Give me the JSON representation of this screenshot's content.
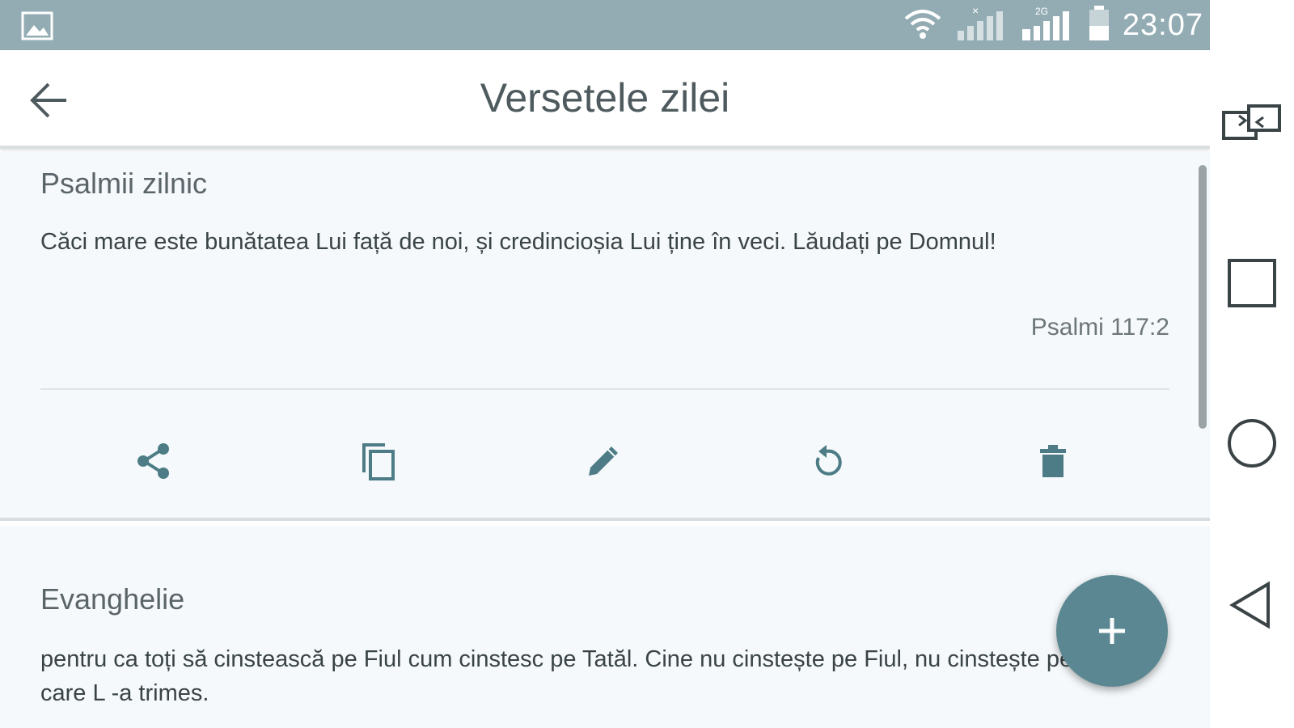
{
  "status_bar": {
    "time": "23:07",
    "icons": [
      "image-icon",
      "wifi-icon",
      "signal-icon",
      "signal-2g-icon",
      "battery-icon"
    ]
  },
  "toolbar": {
    "title": "Versetele zilei",
    "back_icon": "arrow-back-icon"
  },
  "cards": [
    {
      "title": "Psalmii zilnic",
      "text": "Căci mare este bunătatea Lui față de noi, și credincioșia Lui ține în veci. Lăudați pe Domnul!",
      "reference": "Psalmi 117:2",
      "actions": [
        "share-icon",
        "copy-icon",
        "edit-icon",
        "refresh-icon",
        "delete-icon"
      ]
    },
    {
      "title": "Evanghelie",
      "text": "pentru ca toți să cinstească pe Fiul cum cinstesc pe Tatăl. Cine nu cinstește pe Fiul, nu cinstește pe Tatăl, care L -a trimes."
    }
  ],
  "fab": {
    "icon": "add-icon"
  },
  "nav_bar": {
    "buttons": [
      "screen-switch-icon",
      "recents-icon",
      "home-icon",
      "back-triangle-icon"
    ]
  },
  "colors": {
    "status_bar": "#93acb3",
    "accent": "#5a8791",
    "icon": "#4d7c86",
    "card_bg": "#f5f9fb"
  }
}
